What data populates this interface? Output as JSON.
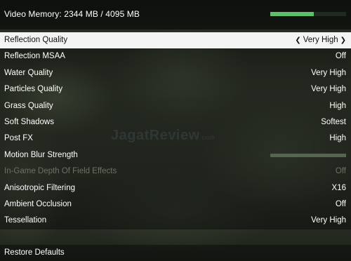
{
  "header": {
    "video_memory_label": "Video Memory: 2344 MB / 4095 MB",
    "video_memory_used_fraction": 0.572
  },
  "settings": [
    {
      "label": "Reflection Quality",
      "value": "Very High",
      "selected": true
    },
    {
      "label": "Reflection MSAA",
      "value": "Off"
    },
    {
      "label": "Water Quality",
      "value": "Very High"
    },
    {
      "label": "Particles Quality",
      "value": "Very High"
    },
    {
      "label": "Grass Quality",
      "value": "High"
    },
    {
      "label": "Soft Shadows",
      "value": "Softest"
    },
    {
      "label": "Post FX",
      "value": "High"
    },
    {
      "label": "Motion Blur Strength",
      "slider_fraction": 1.0
    },
    {
      "label": "In-Game Depth Of Field Effects",
      "value": "Off",
      "disabled": true
    },
    {
      "label": "Anisotropic Filtering",
      "value": "X16"
    },
    {
      "label": "Ambient Occlusion",
      "value": "Off"
    },
    {
      "label": "Tessellation",
      "value": "Very High"
    }
  ],
  "footer": {
    "restore_defaults_label": "Restore Defaults"
  },
  "watermark": {
    "text": "JagatReview",
    "suffix": ".com"
  },
  "colors": {
    "vram_fill": "#5fbf67",
    "selected_row_bg": "#f4f4f4",
    "disabled_text": "#6d7268"
  }
}
